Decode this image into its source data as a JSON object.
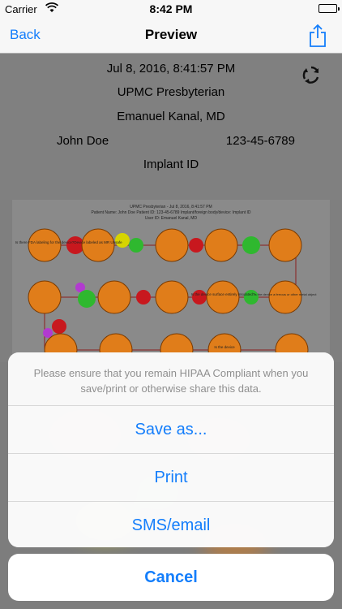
{
  "status_bar": {
    "carrier": "Carrier",
    "time": "8:42 PM"
  },
  "nav": {
    "back_label": "Back",
    "title": "Preview"
  },
  "info": {
    "datetime": "Jul 8, 2016, 8:41:57 PM",
    "hospital": "UPMC Presbyterian",
    "physician": "Emanuel Kanal, MD",
    "patient_name": "John Doe",
    "patient_id": "123-45-6789",
    "implant_label": "Implant ID"
  },
  "flow_header": {
    "line1": "UPMC Presbyterian  -  Jul 8, 2016, 8:41:57 PM",
    "line2": "Patient Name: John Doe   Patient ID: 123-45-6789   Implant/foreign body/device: Implant ID",
    "line3": "User ID: Emanuel Kanal, MD"
  },
  "flow_nodes": {
    "n1": "Is there FDA labeling for the device?",
    "n2": "Device labeled as MR Unsafe",
    "n3": "Is the device surface entirely insulated?",
    "n4": "Is the device",
    "n5": "Is the device a ferrous or other metal object"
  },
  "action_sheet": {
    "message": "Please ensure that you remain HIPAA Compliant when you save/print or otherwise share this data.",
    "buttons": [
      "Save as...",
      "Print",
      "SMS/email"
    ],
    "cancel": "Cancel"
  },
  "colors": {
    "accent": "#147efb",
    "node_orange": "#e07d1a",
    "node_green": "#2fb82f",
    "node_red": "#c8181e",
    "node_yellow": "#d6d400",
    "node_purple": "#b23ad0"
  }
}
